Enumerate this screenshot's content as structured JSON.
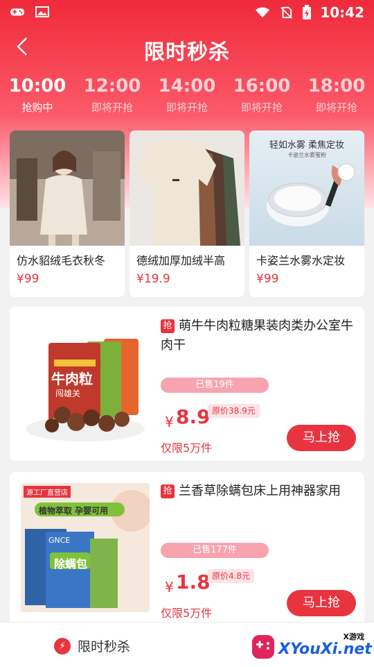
{
  "status": {
    "time": "10:42"
  },
  "header": {
    "title": "限时秒杀"
  },
  "slots": [
    {
      "time": "10:00",
      "status": "抢购中",
      "active": true
    },
    {
      "time": "12:00",
      "status": "即将开抢",
      "active": false
    },
    {
      "time": "14:00",
      "status": "即将开抢",
      "active": false
    },
    {
      "time": "16:00",
      "status": "即将开抢",
      "active": false
    },
    {
      "time": "18:00",
      "status": "即将开抢",
      "active": false
    }
  ],
  "featured": [
    {
      "name": "仿水貂绒毛衣秋冬",
      "price": "¥99"
    },
    {
      "name": "德绒加厚加绒半高",
      "price": "¥19.9"
    },
    {
      "name": "卡姿兰水雾水定妆",
      "price": "¥99",
      "img_text1": "轻如水雾 柔焦定妆",
      "img_text2": "卡姿兰水雾蜜粉"
    }
  ],
  "products": [
    {
      "badge": "抢",
      "name": "萌牛牛肉粒糖果装肉类办公室牛肉干",
      "sold": "已售19件",
      "currency": "¥",
      "price": "8.9",
      "original": "原价38.9元",
      "limit": "仅限5万件",
      "button": "马上抢",
      "img_text": "牛肉粒",
      "img_sub": "闯雄关"
    },
    {
      "badge": "抢",
      "name": "兰香草除螨包床上用神器家用",
      "sold": "已售177件",
      "currency": "¥",
      "price": "1.8",
      "original": "原价4.8元",
      "limit": "仅限5万件",
      "button": "马上抢",
      "img_tag": "源工厂直营店",
      "img_banner": "植物萃取 孕婴可用",
      "img_text": "除螨包",
      "img_brand": "GNCE"
    }
  ],
  "bottom": {
    "tab_label": "限时秒杀",
    "tab_icon": "lightning-icon"
  },
  "watermark": {
    "top": "X游戏",
    "main": "XYouXi.net"
  },
  "colors": {
    "accent": "#e8343f",
    "header_top": "#f02a3a"
  }
}
